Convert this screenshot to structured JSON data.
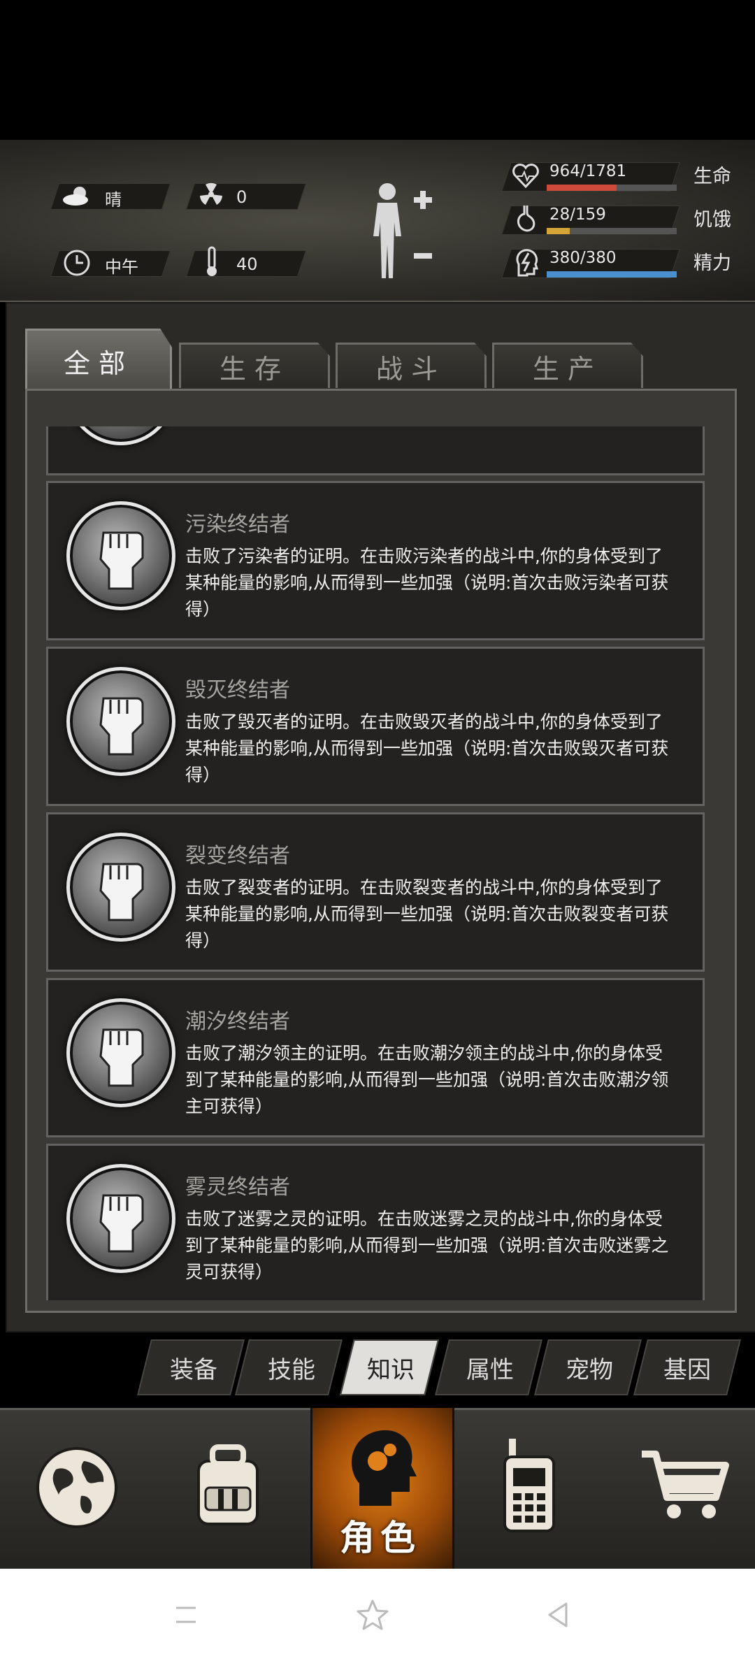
{
  "status": {
    "weather": "晴",
    "radiation": "0",
    "time_of_day": "中午",
    "temperature": "40"
  },
  "vitals": [
    {
      "label": "生命",
      "value": "964/1781",
      "fraction": 0.54,
      "color": "#d04a3c"
    },
    {
      "label": "饥饿",
      "value": "28/159",
      "fraction": 0.18,
      "color": "#d4a437"
    },
    {
      "label": "精力",
      "value": "380/380",
      "fraction": 1.0,
      "color": "#4a8fcf"
    }
  ],
  "tabs": [
    {
      "label": "全部",
      "active": true
    },
    {
      "label": "生存",
      "active": false
    },
    {
      "label": "战斗",
      "active": false
    },
    {
      "label": "生产",
      "active": false
    }
  ],
  "cards": [
    {
      "title": "污染终结者",
      "desc": "击败了污染者的证明。在击败污染者的战斗中,你的身体受到了某种能量的影响,从而得到一些加强（说明:首次击败污染者可获得）"
    },
    {
      "title": "毁灭终结者",
      "desc": "击败了毁灭者的证明。在击败毁灭者的战斗中,你的身体受到了某种能量的影响,从而得到一些加强（说明:首次击败毁灭者可获得）"
    },
    {
      "title": "裂变终结者",
      "desc": "击败了裂变者的证明。在击败裂变者的战斗中,你的身体受到了某种能量的影响,从而得到一些加强（说明:首次击败裂变者可获得）"
    },
    {
      "title": "潮汐终结者",
      "desc": "击败了潮汐领主的证明。在击败潮汐领主的战斗中,你的身体受到了某种能量的影响,从而得到一些加强（说明:首次击败潮汐领主可获得）"
    },
    {
      "title": "雾灵终结者",
      "desc": "击败了迷雾之灵的证明。在击败迷雾之灵的战斗中,你的身体受到了某种能量的影响,从而得到一些加强（说明:首次击败迷雾之灵可获得）"
    }
  ],
  "subtabs": [
    {
      "label": "装备",
      "active": false
    },
    {
      "label": "技能",
      "active": false
    },
    {
      "label": "知识",
      "active": true
    },
    {
      "label": "属性",
      "active": false
    },
    {
      "label": "宠物",
      "active": false
    },
    {
      "label": "基因",
      "active": false
    }
  ],
  "bottom_nav": {
    "role_label": "角色",
    "icons": [
      "globe-icon",
      "backpack-icon",
      "role-head-icon",
      "walkie-talkie-icon",
      "shopping-cart-icon"
    ]
  }
}
